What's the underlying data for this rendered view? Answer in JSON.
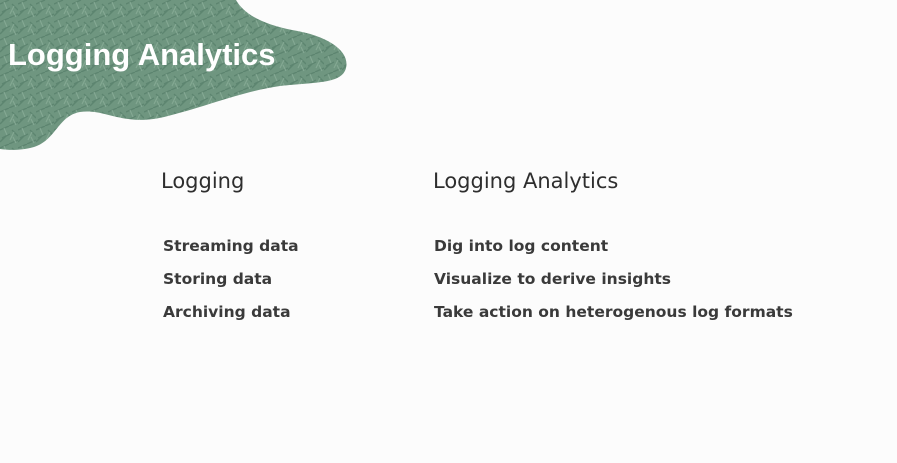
{
  "slide": {
    "title": "Logging Analytics",
    "accent_color": "#6f9680",
    "accent_texture_color": "#5d8570"
  },
  "logging": {
    "heading": "Logging",
    "items": [
      "Streaming data",
      "Storing data",
      "Archiving data"
    ]
  },
  "logging_analytics": {
    "heading": "Logging Analytics",
    "items": [
      "Dig into log content",
      "Visualize to derive insights",
      "Take action on heterogenous log formats"
    ]
  }
}
